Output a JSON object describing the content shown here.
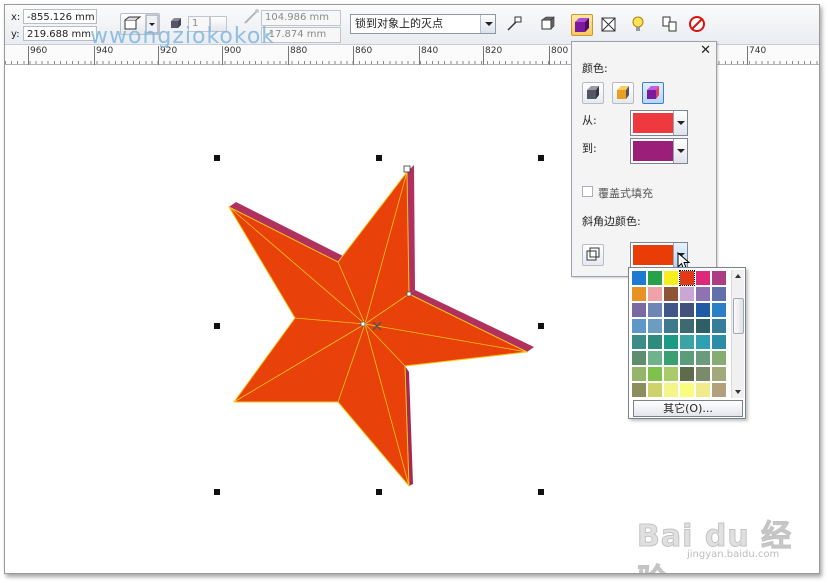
{
  "propbar": {
    "x_label": "x:",
    "x_value": "-855.126 mm",
    "y_label": "y:",
    "y_value": "219.688 mm",
    "steps_value": "1",
    "depth1_value": "104.986 mm",
    "depth2_value": "-17.874 mm",
    "vanish_combo": "锁到对象上的灭点"
  },
  "watermark": "wwongziokokok",
  "ruler": {
    "ticks": [
      "960",
      "940",
      "920",
      "900",
      "880",
      "860",
      "840",
      "820",
      "800",
      "760",
      "740"
    ]
  },
  "panel": {
    "color_label": "颜色:",
    "from_label": "从:",
    "to_label": "到:",
    "overprint_label": "覆盖式填充",
    "bevel_color_label": "斜角边颜色:",
    "from_color": "#ee3a3f",
    "to_color": "#9b1f78",
    "bevel_color": "#ea3c07"
  },
  "palette": {
    "colors": [
      "#1e7ad0",
      "#27a14a",
      "#f6ef1d",
      "#e23a17",
      "#e0287a",
      "#ad3d83",
      "#e99121",
      "#f0a2ab",
      "#8e5438",
      "#c9a6d3",
      "#8f72b1",
      "#616fab",
      "#7a6aa1",
      "#6d86b3",
      "#3f5888",
      "#41517a",
      "#1f5aa7",
      "#2a7fc7",
      "#5f97c6",
      "#6d9cc1",
      "#3d7a8e",
      "#3f6972",
      "#2f5f66",
      "#347e9a",
      "#3d8c87",
      "#2e8c7c",
      "#1b9a86",
      "#3aa3a4",
      "#2fa0b1",
      "#2a8fa6",
      "#5e8d6f",
      "#6fb38d",
      "#3aa070",
      "#5b9c7b",
      "#6b9b7d",
      "#86ab73",
      "#96b56a",
      "#7ec24d",
      "#a9cc6b",
      "#5e6b4c",
      "#7a8b6c",
      "#a3a77c",
      "#8c8e5f",
      "#cfd26b",
      "#f6f58a",
      "#fafc7f",
      "#f0ec8c",
      "#b3a07d"
    ],
    "other_button": "其它(O)..."
  },
  "baidu": {
    "logo_text": "Bai du 经验",
    "url": "jingyan.baidu.com"
  }
}
